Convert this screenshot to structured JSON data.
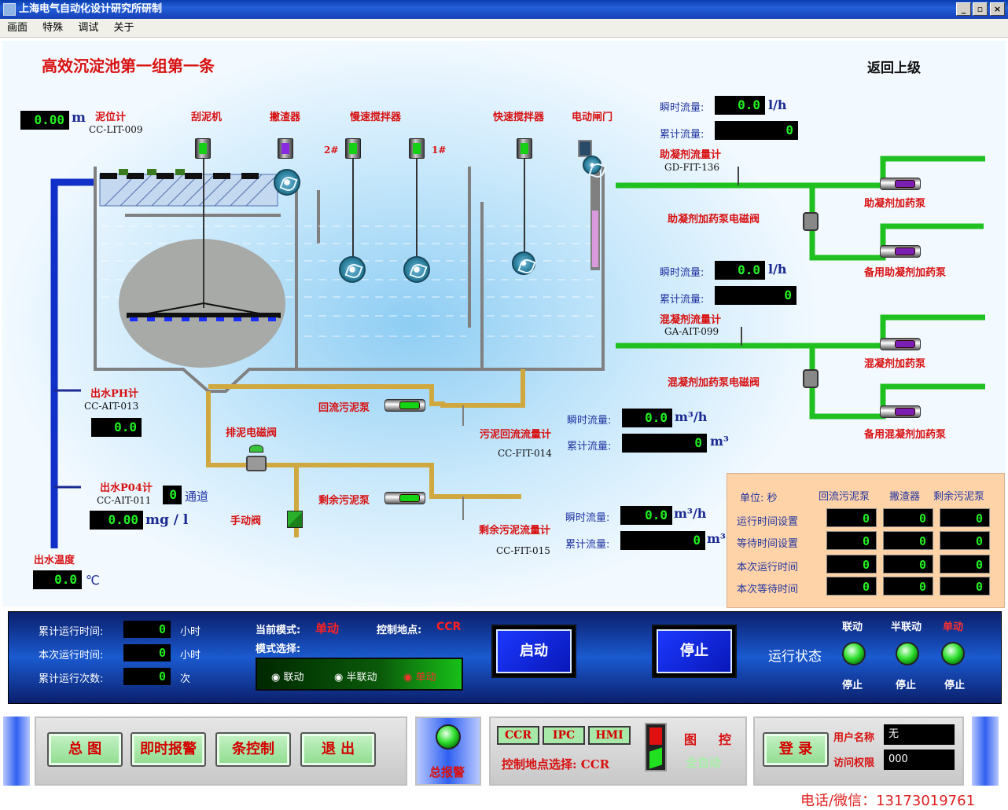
{
  "window": {
    "title": "上海电气自动化设计研究所研制"
  },
  "menu": [
    "画面",
    "特殊",
    "调试",
    "关于"
  ],
  "screen": {
    "title": "高效沉淀池第一组第一条",
    "back": "返回上级"
  },
  "sludge_level": {
    "label": "泥位计",
    "tag": "CC-LIT-009",
    "value": "0.00",
    "unit": "m"
  },
  "equip": {
    "scraper": "刮泥机",
    "skimmer": "撇渣器",
    "slow_mixer": "慢速搅拌器",
    "fast_mixer": "快速搅拌器",
    "gate": "电动闸门",
    "mark2": "2#",
    "mark1": "1#"
  },
  "coagulant_aid": {
    "inst_label": "瞬时流量:",
    "inst_value": "0.0",
    "inst_unit": "l/h",
    "total_label": "累计流量:",
    "total_value": "0",
    "meter": "助凝剂流量计",
    "tag": "GD-FIT-136",
    "valve": "助凝剂加药泵电磁阀",
    "pump": "助凝剂加药泵",
    "spare": "备用助凝剂加药泵"
  },
  "coagulant": {
    "inst_label": "瞬时流量:",
    "inst_value": "0.0",
    "inst_unit": "l/h",
    "total_label": "累计流量:",
    "total_value": "0",
    "meter": "混凝剂流量计",
    "tag": "GA-AIT-099",
    "valve": "混凝剂加药泵电磁阀",
    "pump": "混凝剂加药泵",
    "spare": "备用混凝剂加药泵"
  },
  "ph": {
    "label": "出水PH计",
    "tag": "CC-AIT-013",
    "value": "0.0"
  },
  "po4": {
    "label": "出水P04计",
    "tag": "CC-AIT-011",
    "channel": "0",
    "channel_label": "通道",
    "value": "0.00",
    "unit": "mg / l"
  },
  "temp": {
    "label": "出水温度",
    "value": "0.0",
    "unit": "℃"
  },
  "return_pump": {
    "label": "回流污泥泵",
    "meter": "污泥回流流量计",
    "tag": "CC-FIT-014",
    "inst_label": "瞬时流量:",
    "inst_value": "0.0",
    "inst_unit": "m³/h",
    "total_label": "累计流量:",
    "total_value": "0",
    "total_unit": "m³"
  },
  "excess_pump": {
    "label": "剩余污泥泵",
    "meter": "剩余污泥流量计",
    "tag": "CC-FIT-015",
    "inst_label": "瞬时流量:",
    "inst_value": "0.0",
    "inst_unit": "m³/h",
    "total_label": "累计流量:",
    "total_value": "0",
    "total_unit": "m³"
  },
  "drain_valve": "排泥电磁阀",
  "manual_valve": "手动阀",
  "runtable": {
    "unit": "单位: 秒",
    "cols": [
      "回流污泥泵",
      "撇渣器",
      "剩余污泥泵"
    ],
    "rows": [
      {
        "label": "运行时间设置",
        "values": [
          "0",
          "0",
          "0"
        ]
      },
      {
        "label": "等待时间设置",
        "values": [
          "0",
          "0",
          "0"
        ]
      },
      {
        "label": "本次运行时间",
        "values": [
          "0",
          "0",
          "0"
        ]
      },
      {
        "label": "本次等待时间",
        "values": [
          "0",
          "0",
          "0"
        ]
      }
    ]
  },
  "control": {
    "cum_run_label": "累计运行时间:",
    "cum_run": "0",
    "cum_run_unit": "小时",
    "this_run_label": "本次运行时间:",
    "this_run": "0",
    "this_run_unit": "小时",
    "count_label": "累计运行次数:",
    "count": "0",
    "count_unit": "次",
    "mode_label": "当前模式:",
    "mode": "单动",
    "site_label": "控制地点:",
    "site": "CCR",
    "select_label": "模式选择:",
    "modes": [
      "联动",
      "半联动",
      "单动"
    ],
    "start": "启动",
    "stop": "停止",
    "status_label": "运行状态",
    "status_cols": [
      "联动",
      "半联动",
      "单动"
    ],
    "status_vals": [
      "停止",
      "停止",
      "停止"
    ]
  },
  "nav": {
    "overview": "总 图",
    "alarm": "即时报警",
    "strip": "条控制",
    "exit": "退 出",
    "total_alarm": "总报警",
    "ccr": "CCR",
    "ipc": "IPC",
    "hmi": "HMI",
    "site_select": "控制地点选择: CCR",
    "tu": "图",
    "kong": "控",
    "auto": "全自动",
    "login": "登 录",
    "user_label": "用户名称",
    "user": "无",
    "perm_label": "访问权限",
    "perm": "000"
  },
  "contact": "电话/微信：13173019761"
}
